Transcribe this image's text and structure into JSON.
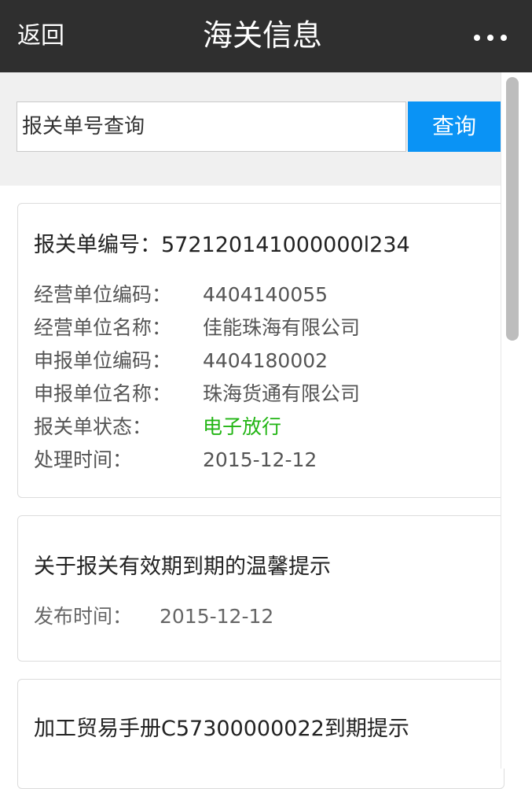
{
  "header": {
    "back_label": "返回",
    "title": "海关信息",
    "more_icon": "more-dots-icon"
  },
  "search": {
    "placeholder": "报关单号查询",
    "value": "",
    "button_label": "查询",
    "accent": "#0a93f5"
  },
  "declaration": {
    "heading_label": "报关单编号：",
    "heading_value": "572120141000000l234",
    "fields": [
      {
        "label": "经营单位编码：",
        "value": "4404140055"
      },
      {
        "label": "经营单位名称：",
        "value": "佳能珠海有限公司"
      },
      {
        "label": "申报单位编码：",
        "value": "4404180002"
      },
      {
        "label": "申报单位名称：",
        "value": "珠海货通有限公司"
      },
      {
        "label": "报关单状态：",
        "value": "电子放行"
      },
      {
        "label": "处理时间：",
        "value": "2015-12-12"
      }
    ],
    "status_color": "#22b514"
  },
  "notices": [
    {
      "title": "关于报关有效期到期的温馨提示",
      "time_label": "发布时间：",
      "time_value": "2015-12-12"
    },
    {
      "title": "加工贸易手册C57300000022到期提示"
    }
  ]
}
